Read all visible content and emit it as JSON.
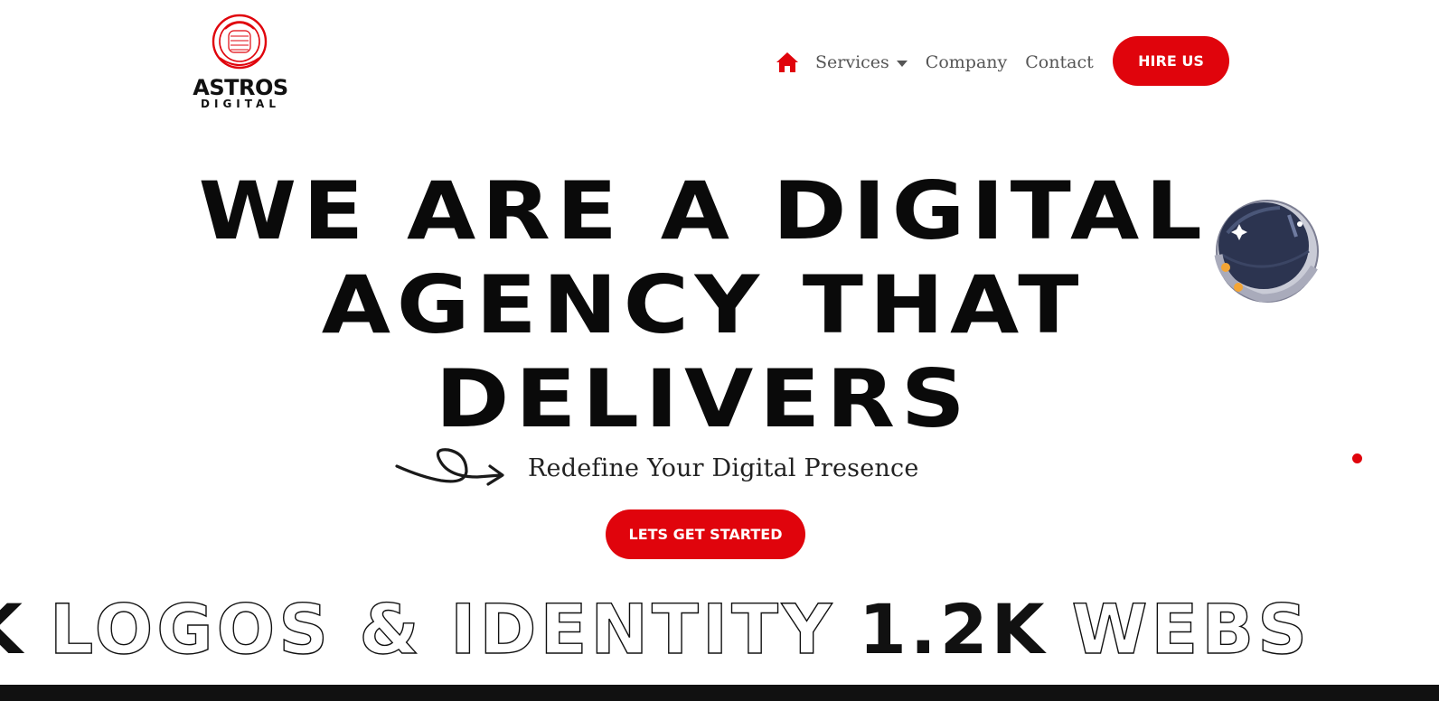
{
  "header": {
    "logo": {
      "name": "ASTROS",
      "sub": "DIGITAL"
    },
    "nav": {
      "home_icon": "home-icon",
      "links": [
        {
          "label": "Services",
          "has_dropdown": true
        },
        {
          "label": "Company",
          "has_dropdown": false
        },
        {
          "label": "Contact",
          "has_dropdown": false
        }
      ]
    },
    "hire_label": "HIRE US"
  },
  "hero": {
    "title_lines": [
      "WE ARE A DIGITAL",
      "AGENCY THAT",
      "DELIVERS"
    ],
    "tagline": "Redefine Your Digital Presence",
    "cta_label": "LETS GET STARTED"
  },
  "marquee": {
    "segments": [
      {
        "text": "K",
        "style": "solid"
      },
      {
        "text": "LOGOS & IDENTITY",
        "style": "outline"
      },
      {
        "text": "1.2K",
        "style": "solid"
      },
      {
        "text": "WEBS",
        "style": "outline"
      }
    ]
  },
  "colors": {
    "accent": "#e0040c",
    "text": "#0a0a0a",
    "nav_text": "#555555"
  }
}
